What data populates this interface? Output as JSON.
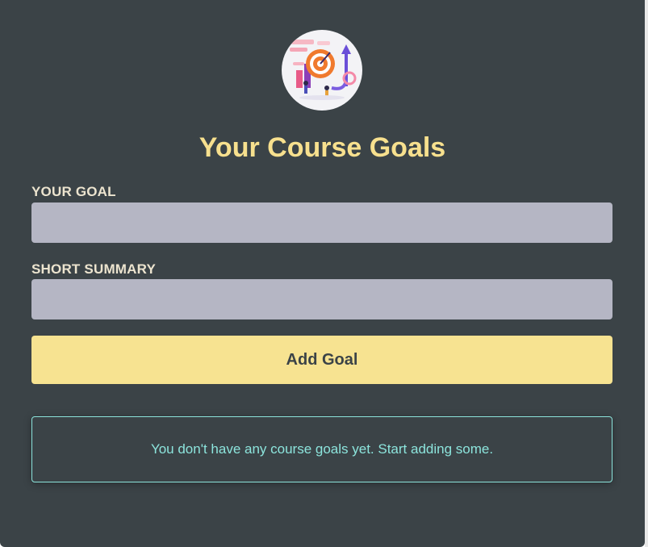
{
  "header": {
    "logo_icon": "goal-target-illustration",
    "title": "Your Course Goals"
  },
  "form": {
    "goal_label": "YOUR GOAL",
    "goal_value": "",
    "summary_label": "SHORT SUMMARY",
    "summary_value": "",
    "submit_label": "Add Goal"
  },
  "goals": {
    "items": [],
    "empty_message": "You don't have any course goals yet. Start adding some."
  },
  "colors": {
    "background": "#3b4347",
    "accent": "#f7e08e",
    "input": "#b5b6c4",
    "info": "#8ce4dc"
  }
}
